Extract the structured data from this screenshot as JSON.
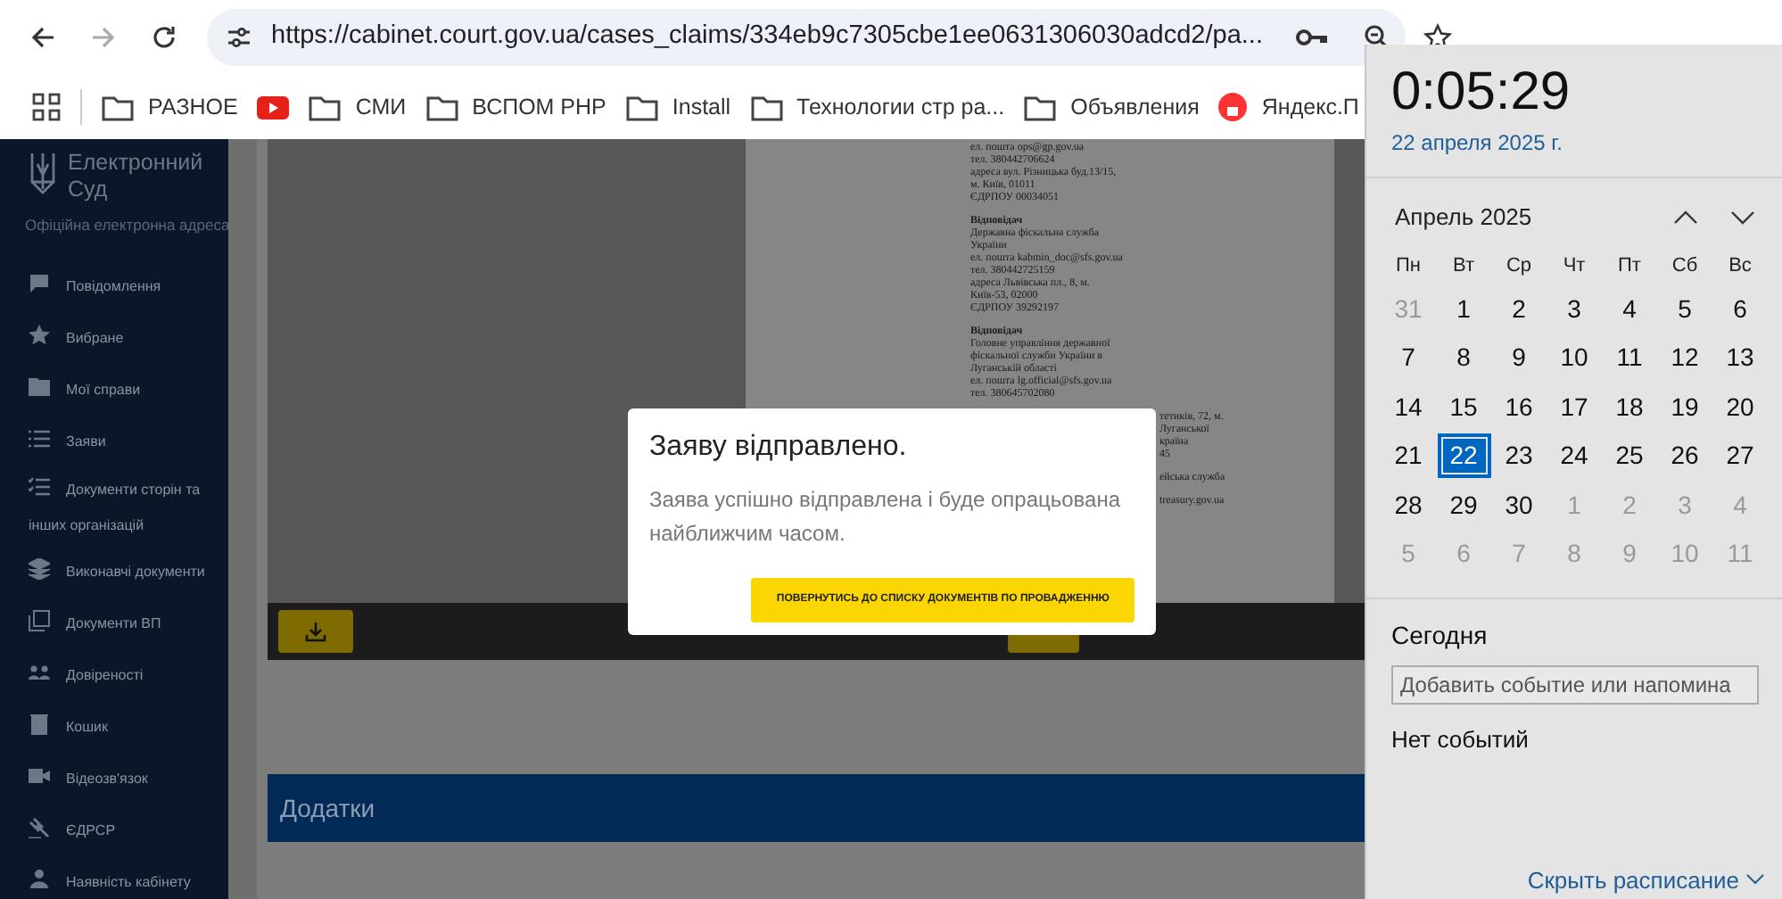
{
  "browser": {
    "url": "https://cabinet.court.gov.ua/cases_claims/334eb9c7305cbe1ee0631306030adcd2/pa...",
    "forward_disabled": true,
    "bookmarks": [
      {
        "kind": "folder",
        "label": "РАЗНОЕ"
      },
      {
        "kind": "video"
      },
      {
        "kind": "folder",
        "label": "СМИ"
      },
      {
        "kind": "folder",
        "label": "ВСПОМ РНР"
      },
      {
        "kind": "folder",
        "label": "Install"
      },
      {
        "kind": "folder",
        "label": "Технологии стр ра..."
      },
      {
        "kind": "folder",
        "label": "Объявления"
      },
      {
        "kind": "site",
        "label": "Яндекс.П"
      }
    ]
  },
  "sidebar": {
    "title": "Електронний Суд",
    "subtitle": "Офіційна електронна адреса",
    "items": [
      {
        "kind": "chat",
        "label": "Повідомлення"
      },
      {
        "kind": "star",
        "label": "Вибране"
      },
      {
        "kind": "folder",
        "label": "Мої справи"
      },
      {
        "kind": "list",
        "label": "Заяви"
      },
      {
        "kind": "checklist",
        "label": "Документи сторін та інших організацій"
      },
      {
        "kind": "layers",
        "label": "Виконавчі документи"
      },
      {
        "kind": "copy",
        "label": "Документи ВП"
      },
      {
        "kind": "people",
        "label": "Довіреності"
      },
      {
        "kind": "trash",
        "label": "Кошик"
      },
      {
        "kind": "video",
        "label": "Відеозв'язок"
      },
      {
        "kind": "gavel",
        "label": "ЄДРСР"
      },
      {
        "kind": "person",
        "label": "Наявність кабінету"
      }
    ]
  },
  "document": {
    "blocks": [
      {
        "cut": false,
        "lines": [
          "ел. пошта ops@gp.gov.ua",
          "тел. 380442706624",
          "адреса вул. Різницька буд.13/15,",
          "м. Київ, 01011",
          "ЄДРПОУ 00034051"
        ]
      },
      {
        "cut": false,
        "heading": "Відповідач",
        "lines": [
          "Державна фіскальна служба",
          "України",
          "ел. пошта kabmin_doc@sfs.gov.ua",
          "тел. 380442725159",
          "адреса Львівська пл., 8, м.",
          "Київ-53, 02000",
          "ЄДРПОУ 39292197"
        ]
      },
      {
        "cut": false,
        "heading": "Відповідач",
        "lines": [
          "Головне управління державної",
          "фіскальної служби України в",
          "Луганській області",
          "ел. пошта lg.official@sfs.gov.ua",
          "тел. 380645702080"
        ]
      },
      {
        "cut": true,
        "lines": [
          "тетиків, 72, м.",
          "Луганської",
          "країна",
          "45"
        ]
      },
      {
        "cut": true,
        "lines": [
          "ейська служба"
        ]
      },
      {
        "cut": true,
        "lines": [
          "treasury.gov.ua"
        ]
      }
    ]
  },
  "attachments": {
    "title": "Додатки"
  },
  "dialog": {
    "title": "Заяву відправлено.",
    "message": "Заява успішно відправлена і буде опрацьована найближчим часом.",
    "button": "ПОВЕРНУТИСЬ ДО СПИСКУ ДОКУМЕНТІВ ПО ПРОВАДЖЕННЮ"
  },
  "calendar": {
    "time": "0:05:29",
    "date": "22 апреля 2025 г.",
    "month": "Апрель 2025",
    "weekdays": [
      "Пн",
      "Вт",
      "Ср",
      "Чт",
      "Пт",
      "Сб",
      "Вс"
    ],
    "days": [
      {
        "label": "31",
        "in_month": false,
        "selected": false
      },
      {
        "label": "1",
        "in_month": true,
        "selected": false
      },
      {
        "label": "2",
        "in_month": true,
        "selected": false
      },
      {
        "label": "3",
        "in_month": true,
        "selected": false
      },
      {
        "label": "4",
        "in_month": true,
        "selected": false
      },
      {
        "label": "5",
        "in_month": true,
        "selected": false
      },
      {
        "label": "6",
        "in_month": true,
        "selected": false
      },
      {
        "label": "7",
        "in_month": true,
        "selected": false
      },
      {
        "label": "8",
        "in_month": true,
        "selected": false
      },
      {
        "label": "9",
        "in_month": true,
        "selected": false
      },
      {
        "label": "10",
        "in_month": true,
        "selected": false
      },
      {
        "label": "11",
        "in_month": true,
        "selected": false
      },
      {
        "label": "12",
        "in_month": true,
        "selected": false
      },
      {
        "label": "13",
        "in_month": true,
        "selected": false
      },
      {
        "label": "14",
        "in_month": true,
        "selected": false
      },
      {
        "label": "15",
        "in_month": true,
        "selected": false
      },
      {
        "label": "16",
        "in_month": true,
        "selected": false
      },
      {
        "label": "17",
        "in_month": true,
        "selected": false
      },
      {
        "label": "18",
        "in_month": true,
        "selected": false
      },
      {
        "label": "19",
        "in_month": true,
        "selected": false
      },
      {
        "label": "20",
        "in_month": true,
        "selected": false
      },
      {
        "label": "21",
        "in_month": true,
        "selected": false
      },
      {
        "label": "22",
        "in_month": true,
        "selected": true
      },
      {
        "label": "23",
        "in_month": true,
        "selected": false
      },
      {
        "label": "24",
        "in_month": true,
        "selected": false
      },
      {
        "label": "25",
        "in_month": true,
        "selected": false
      },
      {
        "label": "26",
        "in_month": true,
        "selected": false
      },
      {
        "label": "27",
        "in_month": true,
        "selected": false
      },
      {
        "label": "28",
        "in_month": true,
        "selected": false
      },
      {
        "label": "29",
        "in_month": true,
        "selected": false
      },
      {
        "label": "30",
        "in_month": true,
        "selected": false
      },
      {
        "label": "1",
        "in_month": false,
        "selected": false
      },
      {
        "label": "2",
        "in_month": false,
        "selected": false
      },
      {
        "label": "3",
        "in_month": false,
        "selected": false
      },
      {
        "label": "4",
        "in_month": false,
        "selected": false
      },
      {
        "label": "5",
        "in_month": false,
        "selected": false
      },
      {
        "label": "6",
        "in_month": false,
        "selected": false
      },
      {
        "label": "7",
        "in_month": false,
        "selected": false
      },
      {
        "label": "8",
        "in_month": false,
        "selected": false
      },
      {
        "label": "9",
        "in_month": false,
        "selected": false
      },
      {
        "label": "10",
        "in_month": false,
        "selected": false
      },
      {
        "label": "11",
        "in_month": false,
        "selected": false
      }
    ],
    "today_label": "Сегодня",
    "event_placeholder": "Добавить событие или напомина",
    "no_events": "Нет событий",
    "hide_link": "Скрыть расписание"
  }
}
